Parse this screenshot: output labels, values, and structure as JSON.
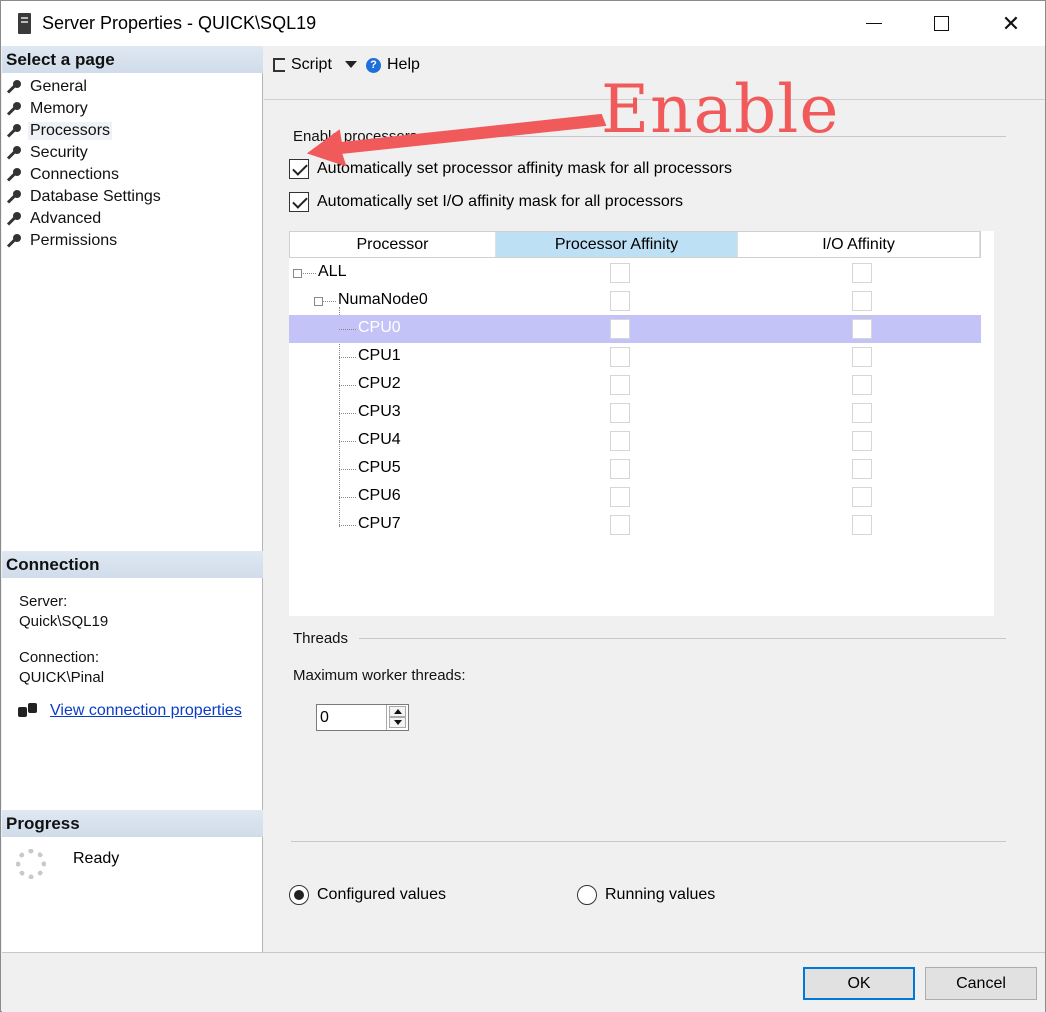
{
  "titlebar": {
    "title": "Server Properties - QUICK\\SQL19",
    "minimize": "minimize",
    "maximize": "maximize",
    "close": "✕"
  },
  "sidebar": {
    "select_page_header": "Select a page",
    "pages": [
      {
        "label": "General",
        "selected": false
      },
      {
        "label": "Memory",
        "selected": false
      },
      {
        "label": "Processors",
        "selected": true
      },
      {
        "label": "Security",
        "selected": false
      },
      {
        "label": "Connections",
        "selected": false
      },
      {
        "label": "Database Settings",
        "selected": false
      },
      {
        "label": "Advanced",
        "selected": false
      },
      {
        "label": "Permissions",
        "selected": false
      }
    ],
    "connection_header": "Connection",
    "server_label": "Server:",
    "server_value": "Quick\\SQL19",
    "connection_label": "Connection:",
    "connection_value": "QUICK\\Pinal",
    "view_link": "View connection properties",
    "progress_header": "Progress",
    "progress_status": "Ready"
  },
  "toolbar": {
    "script_label": "Script",
    "help_label": "Help",
    "help_glyph": "?"
  },
  "processors": {
    "group_label": "Enable processors",
    "auto_processor_affinity": {
      "label": "Automatically set processor affinity mask for all processors",
      "checked": true
    },
    "auto_io_affinity": {
      "label": "Automatically set I/O affinity mask for all processors",
      "checked": true
    },
    "grid": {
      "columns": [
        "Processor",
        "Processor Affinity",
        "I/O Affinity"
      ],
      "rows": [
        {
          "name": "ALL",
          "level": 0,
          "selected": false
        },
        {
          "name": "NumaNode0",
          "level": 1,
          "selected": false
        },
        {
          "name": "CPU0",
          "level": 2,
          "selected": true
        },
        {
          "name": "CPU1",
          "level": 2,
          "selected": false
        },
        {
          "name": "CPU2",
          "level": 2,
          "selected": false
        },
        {
          "name": "CPU3",
          "level": 2,
          "selected": false
        },
        {
          "name": "CPU4",
          "level": 2,
          "selected": false
        },
        {
          "name": "CPU5",
          "level": 2,
          "selected": false
        },
        {
          "name": "CPU6",
          "level": 2,
          "selected": false
        },
        {
          "name": "CPU7",
          "level": 2,
          "selected": false
        }
      ]
    }
  },
  "threads": {
    "group_label": "Threads",
    "max_worker_label": "Maximum worker threads:",
    "max_worker_value": "0"
  },
  "values_mode": {
    "configured_label": "Configured  values",
    "running_label": "Running values",
    "selected": "configured"
  },
  "footer": {
    "ok_label": "OK",
    "cancel_label": "Cancel"
  },
  "annotation": {
    "text": "Enable",
    "color": "#f05a5a"
  },
  "colors": {
    "selected_row": "#c3c3f7",
    "header_highlight": "#bee0f5",
    "link": "#0a3cc8",
    "default_button_border": "#0078d7"
  }
}
